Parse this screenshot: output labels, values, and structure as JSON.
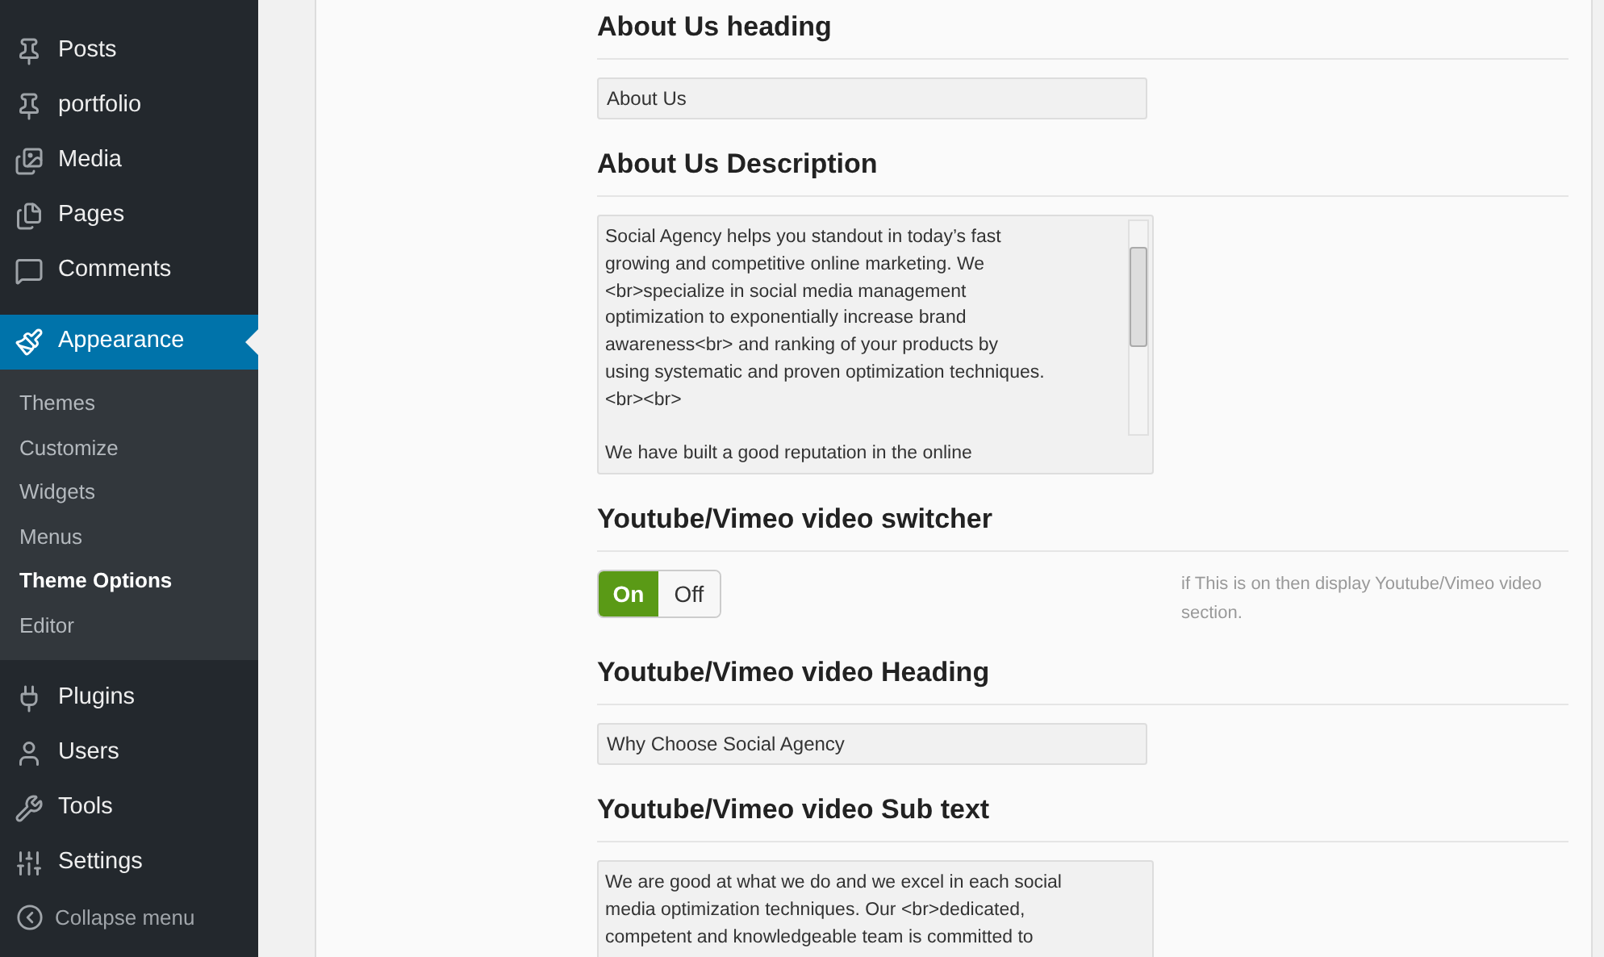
{
  "sidebar": {
    "items": [
      {
        "kind": "posts",
        "label": "Posts",
        "selected": false
      },
      {
        "kind": "posts",
        "label": "portfolio",
        "selected": false
      },
      {
        "kind": "media",
        "label": "Media",
        "selected": false
      },
      {
        "kind": "pages",
        "label": "Pages",
        "selected": false
      },
      {
        "kind": "comments",
        "label": "Comments",
        "selected": false
      },
      {
        "kind": "appearance",
        "label": "Appearance",
        "selected": true,
        "children": [
          {
            "label": "Themes",
            "selected": false
          },
          {
            "label": "Customize",
            "selected": false
          },
          {
            "label": "Widgets",
            "selected": false
          },
          {
            "label": "Menus",
            "selected": false
          },
          {
            "label": "Theme Options",
            "selected": true
          },
          {
            "label": "Editor",
            "selected": false
          }
        ]
      },
      {
        "kind": "plugins",
        "label": "Plugins",
        "selected": false
      },
      {
        "kind": "users",
        "label": "Users",
        "selected": false
      },
      {
        "kind": "tools",
        "label": "Tools",
        "selected": false
      },
      {
        "kind": "settings",
        "label": "Settings",
        "selected": false
      }
    ],
    "collapse": "Collapse menu"
  },
  "fields": [
    {
      "kind": "text",
      "heading": "About Us heading",
      "value": "About Us"
    },
    {
      "kind": "textarea",
      "heading": "About Us Description",
      "scrollbar": true,
      "paragraphs": [
        [
          "Social Agency helps you standout in today’s fast",
          "growing and competitive online marketing. We",
          "<br>specialize in social media management",
          "optimization to exponentially increase brand",
          "awareness<br> and ranking of your products by",
          "using systematic and proven optimization techniques.",
          "<br><br>"
        ],
        [
          "We have built a good reputation in the online"
        ]
      ]
    },
    {
      "kind": "switch",
      "heading": "Youtube/Vimeo video switcher",
      "on": true,
      "on_label": "On",
      "off_label": "Off",
      "description": "if This is on then display Youtube/Vimeo video section."
    },
    {
      "kind": "text",
      "heading": "Youtube/Vimeo video Heading",
      "value": "Why Choose Social Agency"
    },
    {
      "kind": "textarea",
      "heading": "Youtube/Vimeo video Sub text",
      "paragraphs": [
        [
          "We are good at what we do and we excel in each social",
          "media optimization techniques. Our <br>dedicated,",
          "competent and knowledgeable team is committed to"
        ]
      ]
    }
  ]
}
